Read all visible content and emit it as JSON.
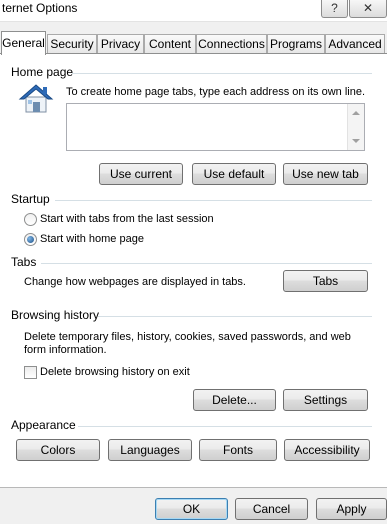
{
  "window": {
    "title": "Internet Options",
    "title_visible": "ternet Options",
    "help_glyph": "?",
    "close_glyph": "✕"
  },
  "tabs": [
    {
      "label": "General",
      "active": true
    },
    {
      "label": "Security"
    },
    {
      "label": "Privacy"
    },
    {
      "label": "Content"
    },
    {
      "label": "Connections"
    },
    {
      "label": "Programs"
    },
    {
      "label": "Advanced"
    }
  ],
  "home_page": {
    "header": "Home page",
    "description": "To create home page tabs, type each address on its own line.",
    "value": "",
    "icon": "house-icon",
    "buttons": {
      "use_current": "Use current",
      "use_default": "Use default",
      "use_new_tab": "Use new tab"
    }
  },
  "startup": {
    "header": "Startup",
    "options": [
      {
        "label": "Start with tabs from the last session",
        "checked": false
      },
      {
        "label": "Start with home page",
        "checked": true
      }
    ]
  },
  "tabs_group": {
    "header": "Tabs",
    "description": "Change how webpages are displayed in tabs.",
    "button": "Tabs"
  },
  "browsing_history": {
    "header": "Browsing history",
    "description_line1": "Delete temporary files, history, cookies, saved passwords, and web",
    "description_line2": "form information.",
    "delete_on_exit_label": "Delete browsing history on exit",
    "delete_on_exit_checked": false,
    "delete_button": "Delete...",
    "settings_button": "Settings"
  },
  "appearance": {
    "header": "Appearance",
    "buttons": {
      "colors": "Colors",
      "languages": "Languages",
      "fonts": "Fonts",
      "accessibility": "Accessibility"
    }
  },
  "footer": {
    "ok": "OK",
    "cancel": "Cancel",
    "apply": "Apply"
  },
  "colors": {
    "accent": "#3c7fb1",
    "group_line": "#d5dfe5",
    "house_roof": "#2e6bb8"
  }
}
